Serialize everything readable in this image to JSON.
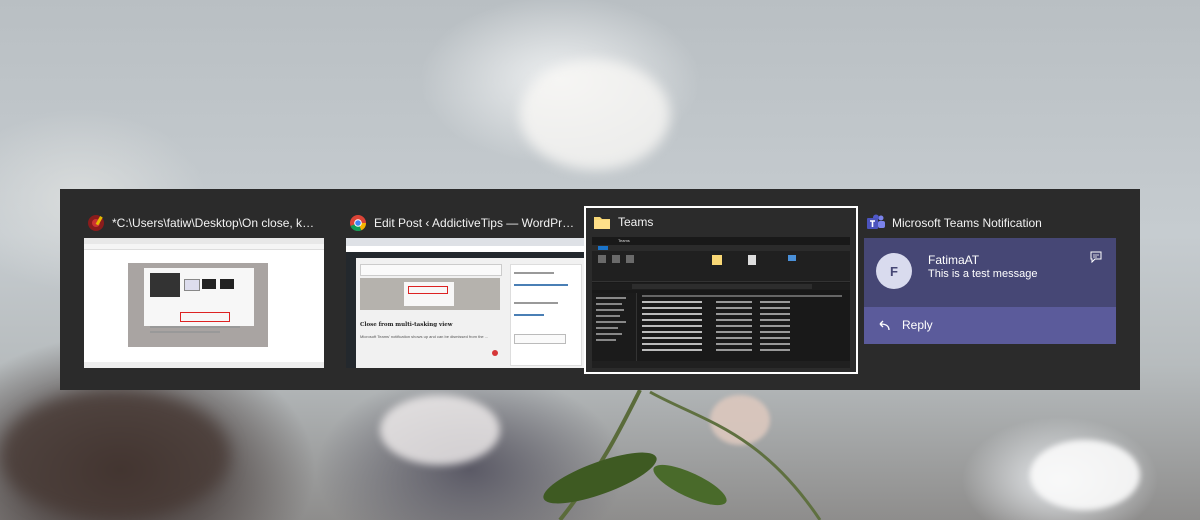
{
  "task_switcher": {
    "windows": [
      {
        "title": "*C:\\Users\\fatiw\\Desktop\\On close, keep a...",
        "icon": "notepad-plus-plus-icon"
      },
      {
        "title": "Edit Post ‹ AddictiveTips — WordPress - G...",
        "icon": "chrome-icon",
        "thumb_heading": "Close from multi-tasking view",
        "thumb_body": "Microsoft Teams' notification shows up and can be dismissed from the ..."
      },
      {
        "title": "Teams",
        "icon": "folder-icon",
        "selected": true,
        "thumb_path": "Teams"
      },
      {
        "title": "Microsoft Teams Notification",
        "icon": "teams-icon",
        "notification": {
          "avatar_initial": "F",
          "sender": "FatimaAT",
          "message": "This is a test message",
          "reply_label": "Reply"
        }
      }
    ]
  },
  "colors": {
    "switcher_bg": "#2b2b2b",
    "teams_purple": "#464775",
    "teams_reply_bar": "#5b5b9b"
  }
}
